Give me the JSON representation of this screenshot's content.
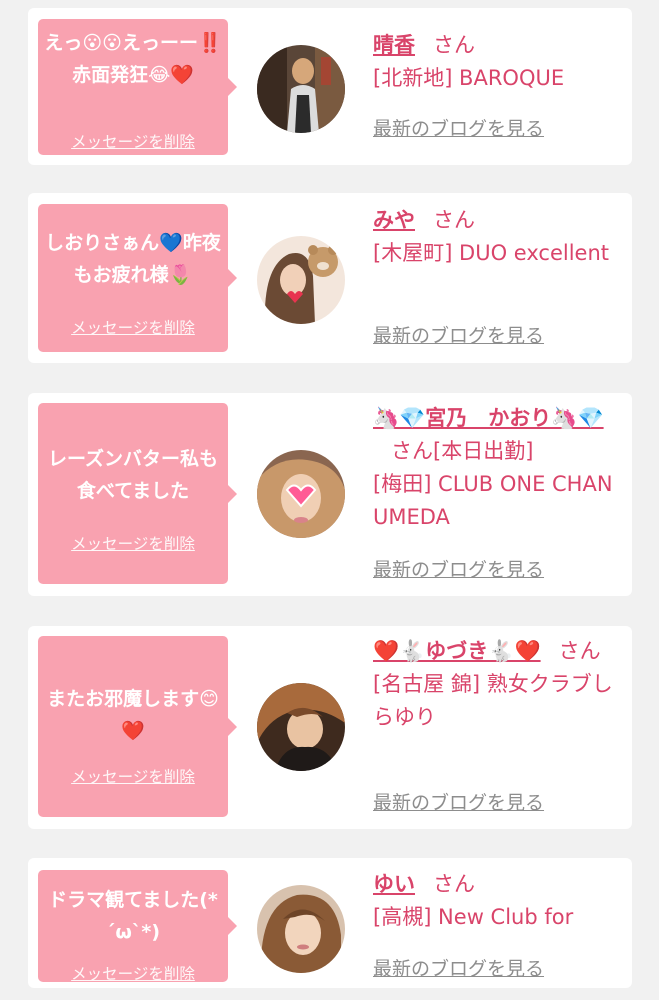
{
  "entries": [
    {
      "message": "えっ😮😮えっーー‼️赤面発狂😂❤️",
      "delete_label": "メッセージを削除",
      "name": "晴香",
      "honorific": "さん",
      "status": "",
      "shop": "[北新地] BAROQUE",
      "blog_label": "最新のブログを見る",
      "avatar_icon": "woman-photo-icon"
    },
    {
      "message": "しおりさぁん💙昨夜もお疲れ様🌷",
      "delete_label": "メッセージを削除",
      "name": "みや",
      "honorific": "さん",
      "status": "",
      "shop": "[木屋町] DUO excellent",
      "blog_label": "最新のブログを見る",
      "avatar_icon": "woman-photo-icon"
    },
    {
      "message": "レーズンバター私も食べてました",
      "delete_label": "メッセージを削除",
      "name": "🦄💎宮乃　かおり🦄💎",
      "honorific": "さん",
      "status": "[本日出勤]",
      "shop": "[梅田] CLUB ONE CHAN UMEDA",
      "blog_label": "最新のブログを見る",
      "avatar_icon": "woman-photo-icon"
    },
    {
      "message": "またお邪魔します😊❤️",
      "delete_label": "メッセージを削除",
      "name": "❤️🐇ゆづき🐇❤️",
      "honorific": "さん",
      "status": "",
      "shop": "[名古屋 錦] 熟女クラブしらゆり",
      "blog_label": "最新のブログを見る",
      "avatar_icon": "woman-photo-icon"
    },
    {
      "message": "ドラマ観てました(*´ω`*)",
      "delete_label": "メッセージを削除",
      "name": "ゆい",
      "honorific": "さん",
      "status": "",
      "shop": "[高槻] New Club for",
      "blog_label": "最新のブログを見る",
      "avatar_icon": "woman-photo-icon"
    }
  ],
  "colors": {
    "page_background": "#f1f1f1",
    "card_background": "#ffffff",
    "bubble_pink": "#f9a2b0",
    "accent_text": "#d9446a",
    "blog_link_gray": "#8d8d8d"
  }
}
